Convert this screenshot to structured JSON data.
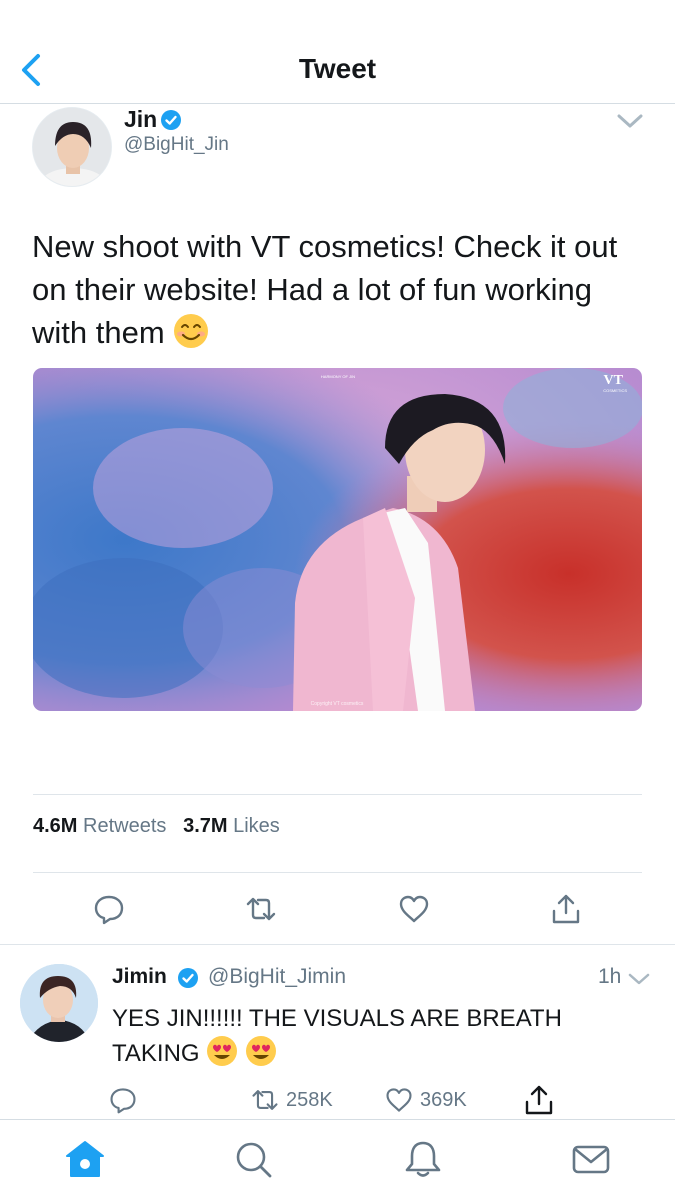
{
  "header": {
    "title": "Tweet"
  },
  "tweet": {
    "author_name": "Jin",
    "author_handle": "@BigHit_Jin",
    "text": "New shoot with VT cosmetics! Check it out on their website! Had a lot of fun working with them",
    "media": {
      "brand_text": "VT",
      "brand_sub": "COSMETICS",
      "top_label": "HARMONY OF JIN",
      "copyright": "Copyright VT cosmetics"
    },
    "retweets_count": "4.6M",
    "retweets_label": "Retweets",
    "likes_count": "3.7M",
    "likes_label": "Likes"
  },
  "reply": {
    "author_name": "Jimin",
    "author_handle": "@BigHit_Jimin",
    "time": "1h",
    "text": "YES JIN!!!!!! THE VISUALS ARE BREATH TAKING",
    "retweets": "258K",
    "likes": "369K"
  },
  "colors": {
    "accent": "#1da1f2",
    "text": "#14171a",
    "secondary": "#657786"
  },
  "icons": {
    "back": "chevron-left-icon",
    "verified": "verified-badge-icon",
    "caret": "chevron-down-icon",
    "reply": "reply-icon",
    "retweet": "retweet-icon",
    "like": "heart-icon",
    "share": "share-icon",
    "home": "home-icon",
    "search": "search-icon",
    "notifications": "bell-icon",
    "messages": "mail-icon"
  }
}
